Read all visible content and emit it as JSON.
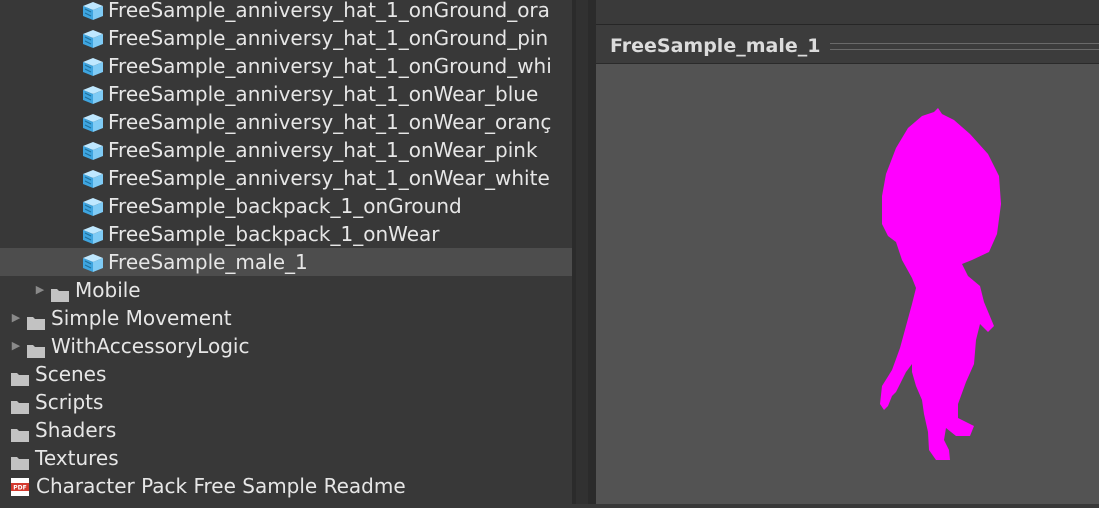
{
  "project_tree": {
    "rows": [
      {
        "label": "FreeSample_anniversy_hat_1_onGround_ora",
        "icon": "prefab-icon",
        "indent": 2,
        "selected": false
      },
      {
        "label": "FreeSample_anniversy_hat_1_onGround_pin",
        "icon": "prefab-icon",
        "indent": 2,
        "selected": false
      },
      {
        "label": "FreeSample_anniversy_hat_1_onGround_whi",
        "icon": "prefab-icon",
        "indent": 2,
        "selected": false
      },
      {
        "label": "FreeSample_anniversy_hat_1_onWear_blue",
        "icon": "prefab-icon",
        "indent": 2,
        "selected": false
      },
      {
        "label": "FreeSample_anniversy_hat_1_onWear_oranç",
        "icon": "prefab-icon",
        "indent": 2,
        "selected": false
      },
      {
        "label": "FreeSample_anniversy_hat_1_onWear_pink",
        "icon": "prefab-icon",
        "indent": 2,
        "selected": false
      },
      {
        "label": "FreeSample_anniversy_hat_1_onWear_white",
        "icon": "prefab-icon",
        "indent": 2,
        "selected": false
      },
      {
        "label": "FreeSample_backpack_1_onGround",
        "icon": "prefab-icon",
        "indent": 2,
        "selected": false
      },
      {
        "label": "FreeSample_backpack_1_onWear",
        "icon": "prefab-icon",
        "indent": 2,
        "selected": false
      },
      {
        "label": "FreeSample_male_1",
        "icon": "prefab-icon",
        "indent": 2,
        "selected": true
      },
      {
        "label": "Mobile",
        "icon": "folder-icon",
        "indent": 1,
        "expander": true,
        "selected": false
      },
      {
        "label": "Simple Movement",
        "icon": "folder-icon",
        "indent": 0,
        "expander": true,
        "selected": false
      },
      {
        "label": "WithAccessoryLogic",
        "icon": "folder-icon",
        "indent": 0,
        "expander": true,
        "selected": false
      },
      {
        "label": "Scenes",
        "icon": "folder-icon",
        "indent": -1,
        "selected": false
      },
      {
        "label": "Scripts",
        "icon": "folder-icon",
        "indent": -1,
        "selected": false
      },
      {
        "label": "Shaders",
        "icon": "folder-icon",
        "indent": -1,
        "selected": false
      },
      {
        "label": "Textures",
        "icon": "folder-icon",
        "indent": -1,
        "selected": false
      },
      {
        "label": "Character Pack Free Sample Readme",
        "icon": "pdf-icon",
        "indent": -1,
        "selected": false
      }
    ]
  },
  "preview": {
    "title": "FreeSample_male_1",
    "model_color": "#ff00ff",
    "background_color": "#535353"
  },
  "colors": {
    "panel_bg": "#383838",
    "selected_row_bg": "#4d4d4d",
    "text": "#e6e6e6"
  }
}
